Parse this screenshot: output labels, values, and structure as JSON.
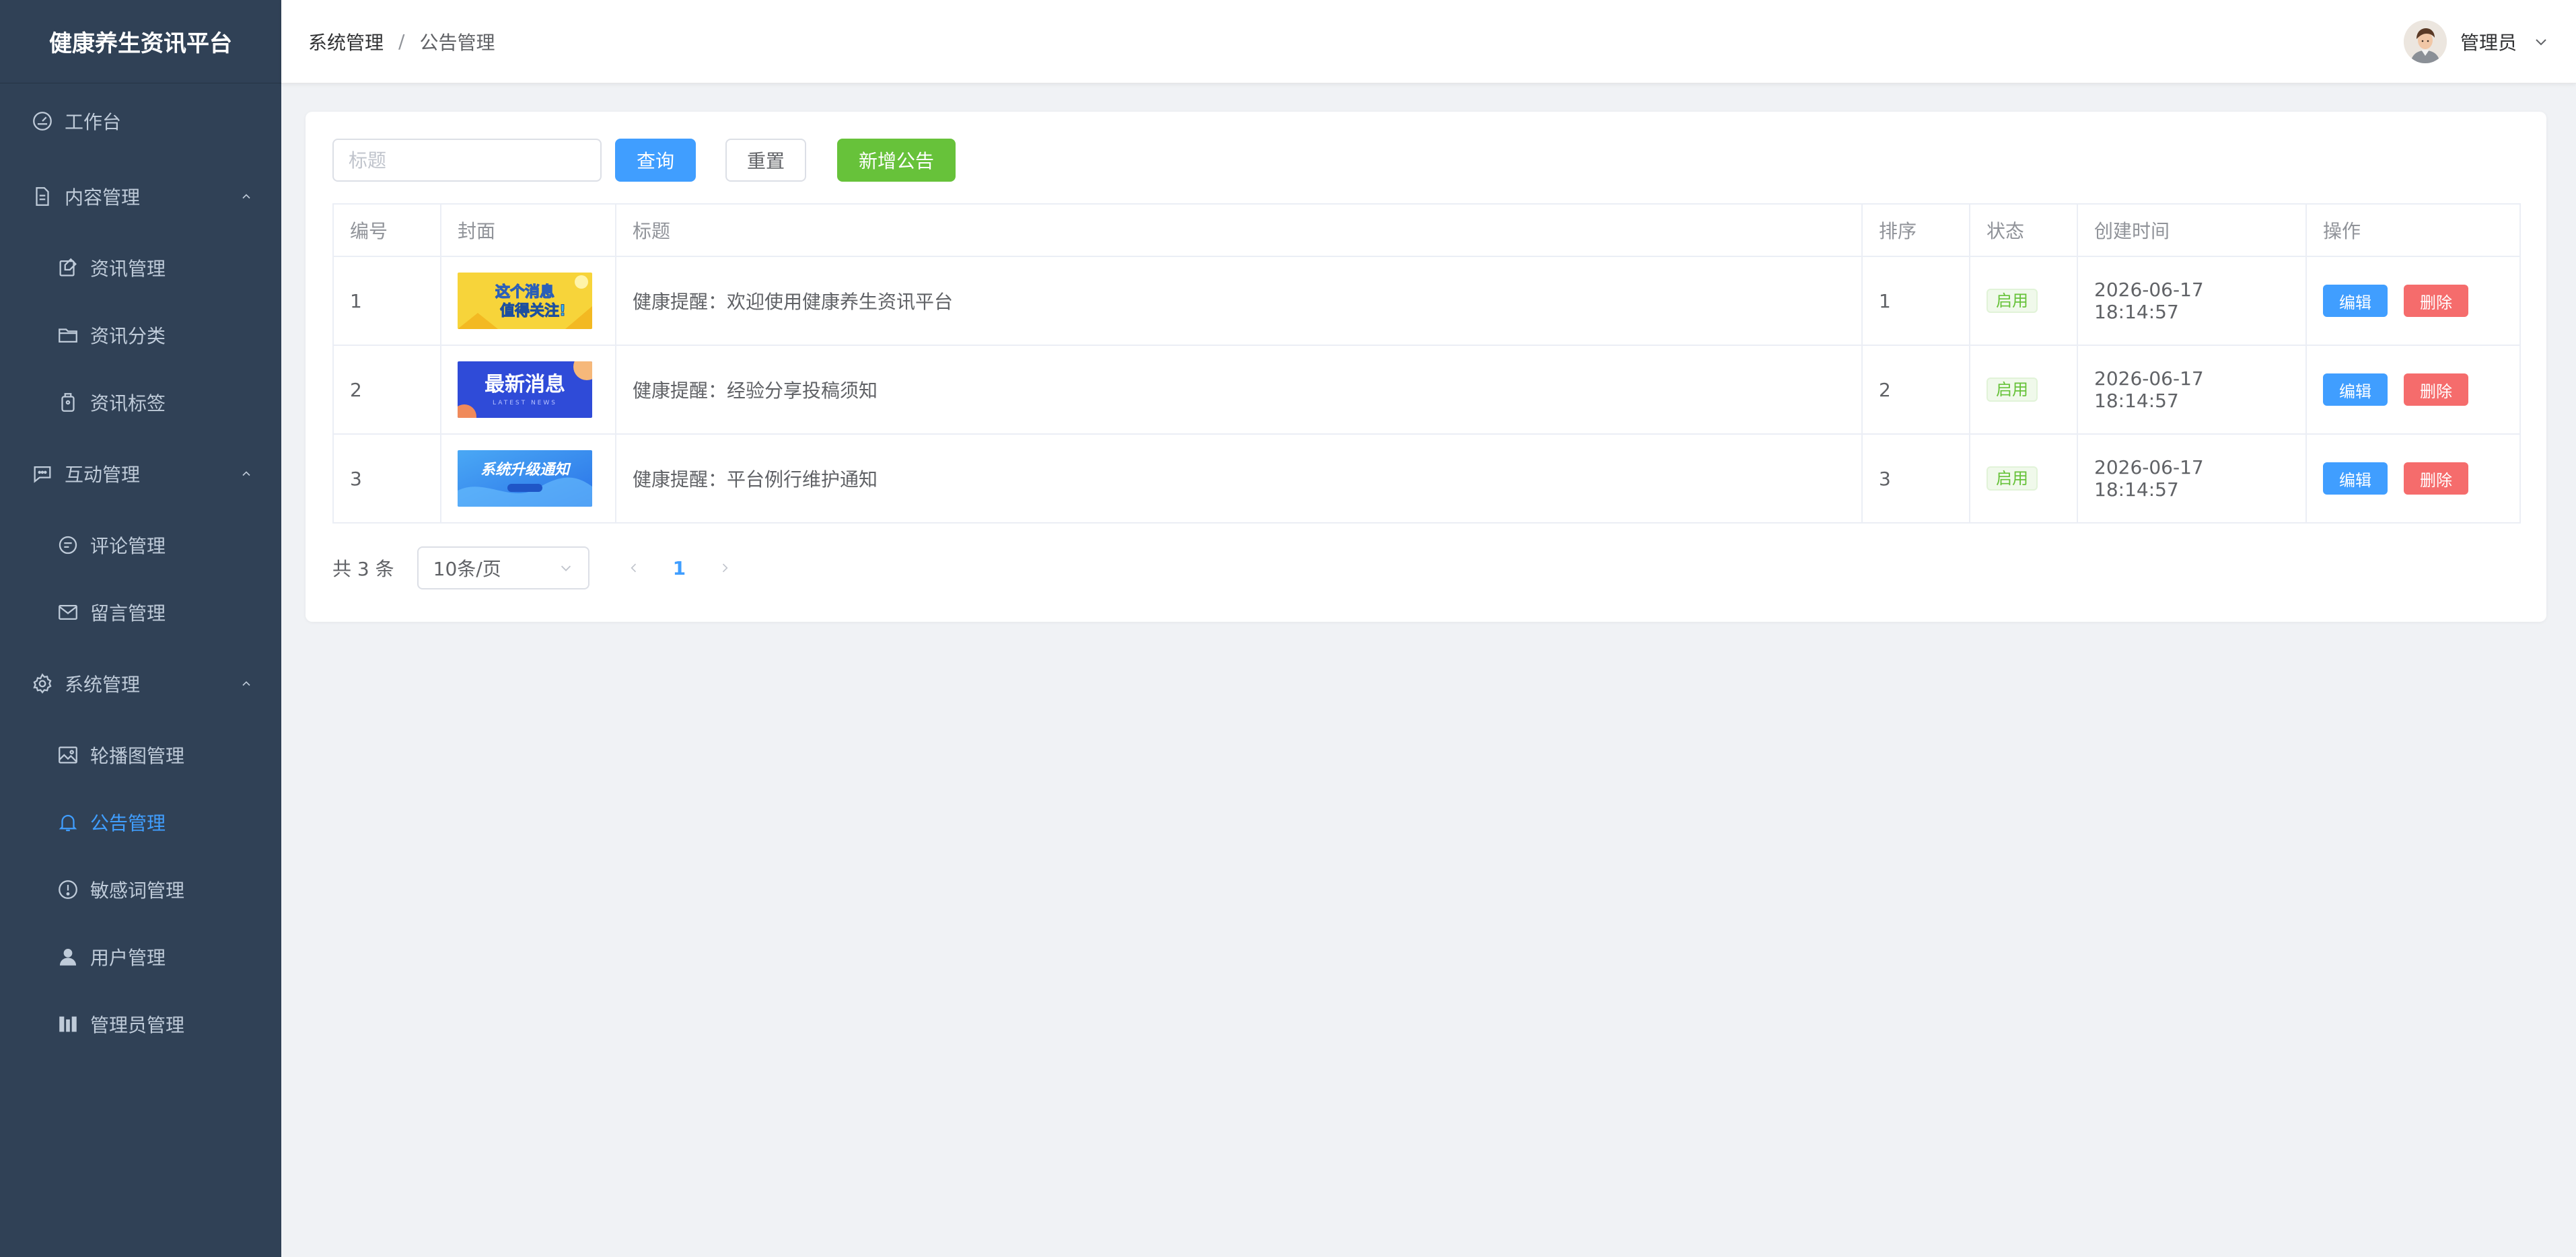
{
  "sidebar": {
    "title": "健康养生资讯平台",
    "items": [
      {
        "label": "工作台",
        "icon": "dashboard-icon",
        "level": "top"
      },
      {
        "label": "内容管理",
        "icon": "document-icon",
        "level": "top",
        "expanded": true
      },
      {
        "label": "资讯管理",
        "icon": "news-edit-icon",
        "level": "sub"
      },
      {
        "label": "资讯分类",
        "icon": "folder-icon",
        "level": "sub"
      },
      {
        "label": "资讯标签",
        "icon": "tag-icon",
        "level": "sub"
      },
      {
        "label": "互动管理",
        "icon": "chat-icon",
        "level": "top",
        "expanded": true
      },
      {
        "label": "评论管理",
        "icon": "comment-icon",
        "level": "sub"
      },
      {
        "label": "留言管理",
        "icon": "mail-icon",
        "level": "sub"
      },
      {
        "label": "系统管理",
        "icon": "gear-icon",
        "level": "top",
        "expanded": true
      },
      {
        "label": "轮播图管理",
        "icon": "picture-icon",
        "level": "sub"
      },
      {
        "label": "公告管理",
        "icon": "bell-icon",
        "level": "sub",
        "active": true
      },
      {
        "label": "敏感词管理",
        "icon": "warning-icon",
        "level": "sub"
      },
      {
        "label": "用户管理",
        "icon": "user-icon",
        "level": "sub"
      },
      {
        "label": "管理员管理",
        "icon": "admin-icon",
        "level": "sub"
      }
    ]
  },
  "header": {
    "breadcrumb": [
      "系统管理",
      "公告管理"
    ],
    "separator": "/",
    "user_name": "管理员"
  },
  "toolbar": {
    "search_placeholder": "标题",
    "search_value": "",
    "query_label": "查询",
    "reset_label": "重置",
    "add_label": "新增公告"
  },
  "table": {
    "columns": [
      "编号",
      "封面",
      "标题",
      "排序",
      "状态",
      "创建时间",
      "操作"
    ],
    "rows": [
      {
        "id": "1",
        "cover": "cover-yellow-banner",
        "title": "健康提醒：欢迎使用健康养生资讯平台",
        "sort": "1",
        "status": "启用",
        "created": "2026-06-17 18:14:57"
      },
      {
        "id": "2",
        "cover": "cover-blue-latest-news",
        "title": "健康提醒：经验分享投稿须知",
        "sort": "2",
        "status": "启用",
        "created": "2026-06-17 18:14:57"
      },
      {
        "id": "3",
        "cover": "cover-lightblue-upgrade",
        "title": "健康提醒：平台例行维护通知",
        "sort": "3",
        "status": "启用",
        "created": "2026-06-17 18:14:57"
      }
    ],
    "edit_label": "编辑",
    "delete_label": "删除"
  },
  "pagination": {
    "total_text": "共 3 条",
    "page_size": "10条/页",
    "current_page": "1"
  },
  "covers": {
    "row1_line1": "这个消息",
    "row1_line2": "值得关注!",
    "row2_main": "最新消息",
    "row2_sub": "LATEST NEWS",
    "row3_main": "系统升级通知"
  },
  "colors": {
    "sidebar_bg": "#304156",
    "sidebar_text": "#bfcbd9",
    "primary": "#409eff",
    "success": "#67c23a",
    "danger": "#f56c6c",
    "page_bg": "#f0f2f5"
  }
}
